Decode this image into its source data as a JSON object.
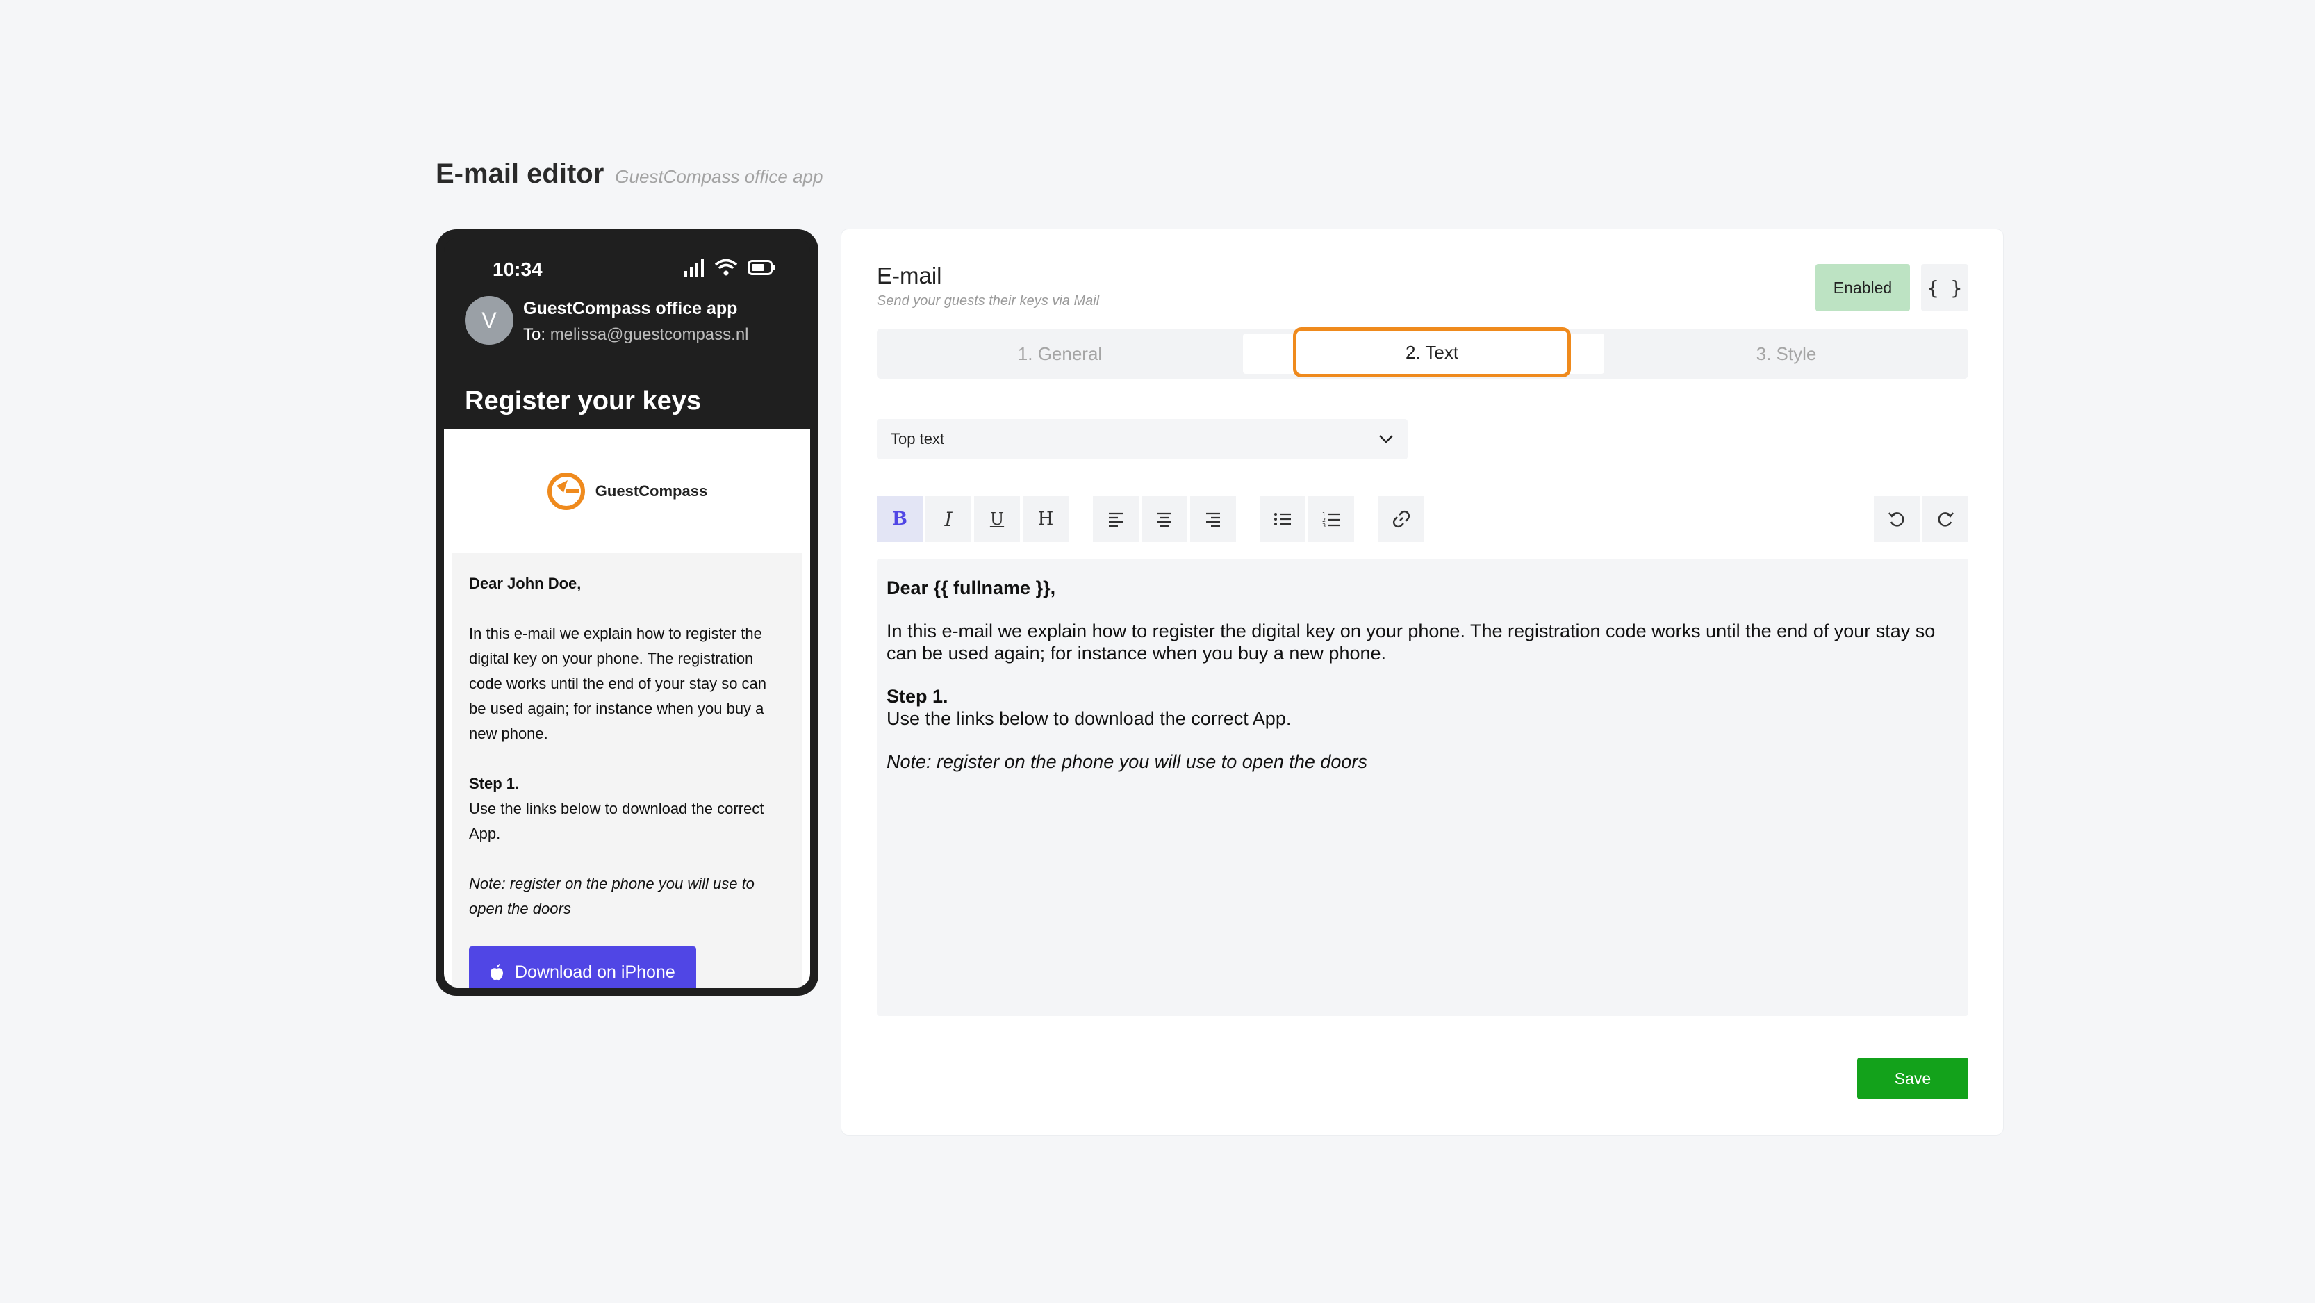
{
  "header": {
    "title": "E-mail editor",
    "subtitle": "GuestCompass office app"
  },
  "phone": {
    "time": "10:34",
    "avatar_letter": "V",
    "sender": "GuestCompass office app",
    "to_label": "To:",
    "to_address": "melissa@guestcompass.nl",
    "subject": "Register your keys",
    "logo_text": "GuestCompass",
    "greeting": "Dear John Doe,",
    "paragraph1": "In this e-mail we explain how to register the digital key on your phone. The registration code works until the end of your stay so can be used again; for instance when you buy a new phone.",
    "step_title": "Step 1.",
    "step_text": "Use the links below to download the correct App.",
    "note": "Note: register on the phone you will use to open the doors",
    "download_button": "Download on iPhone"
  },
  "editor": {
    "title": "E-mail",
    "subtitle": "Send your guests their keys via Mail",
    "enabled_label": "Enabled",
    "braces_label": "{ }",
    "tabs": [
      {
        "label": "1. General"
      },
      {
        "label": "2. Text"
      },
      {
        "label": "3. Style"
      }
    ],
    "select_value": "Top text",
    "content": {
      "greeting": "Dear {{ fullname }},",
      "paragraph1": "In this e-mail we explain how to register the digital key on your phone. The registration code works until the end of your stay so can be used again; for instance when you buy a new phone.",
      "step_title": "Step 1.",
      "step_text": "Use the links below to download the correct App.",
      "note": "Note: register on the phone you will use to open the doors"
    },
    "save_label": "Save",
    "toolbar_icons": [
      "bold-icon",
      "italic-icon",
      "underline-icon",
      "heading-icon",
      "align-left-icon",
      "align-center-icon",
      "align-right-icon",
      "bullet-list-icon",
      "numbered-list-icon",
      "link-icon",
      "undo-icon",
      "redo-icon"
    ]
  },
  "colors": {
    "accent": "#5046e5",
    "tab_highlight": "#ef8a1d",
    "save": "#13a21b",
    "enabled_bg": "#bde3c3"
  }
}
